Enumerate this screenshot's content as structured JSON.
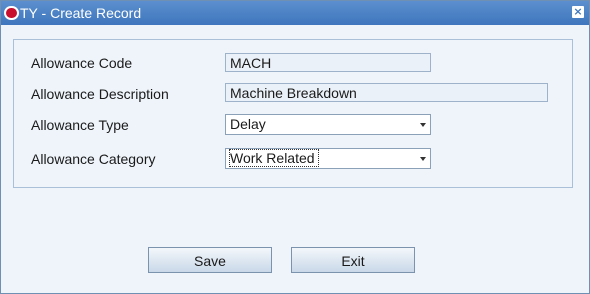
{
  "window": {
    "title": "TY - Create Record",
    "close_glyph": "×"
  },
  "form": {
    "allowance_code": {
      "label": "Allowance Code",
      "value": "MACH"
    },
    "allowance_description": {
      "label": "Allowance Description",
      "value": "Machine Breakdown"
    },
    "allowance_type": {
      "label": "Allowance Type",
      "value": "Delay"
    },
    "allowance_category": {
      "label": "Allowance Category",
      "value": "Work Related"
    }
  },
  "buttons": {
    "save_label": "Save",
    "exit_label": "Exit"
  },
  "colors": {
    "titlebar": "#3f76bd",
    "window_bg": "#eef4fa",
    "logo_red": "#c8102e"
  }
}
